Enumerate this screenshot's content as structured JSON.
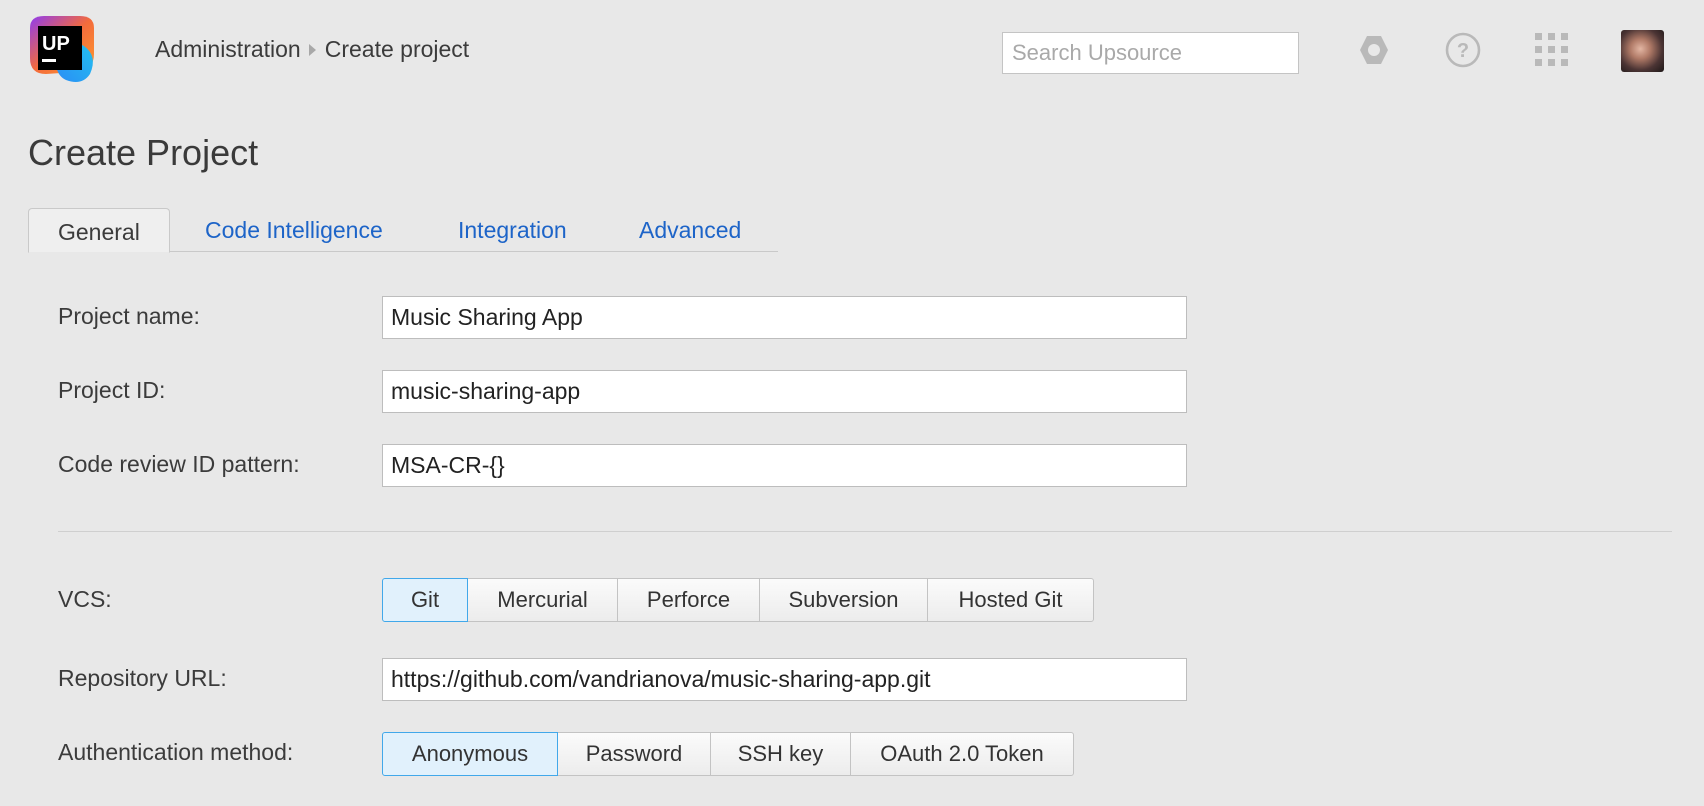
{
  "header": {
    "logo_text": "UP",
    "breadcrumb": {
      "parent": "Administration",
      "current": "Create project"
    },
    "search_placeholder": "Search Upsource"
  },
  "page": {
    "title": "Create Project"
  },
  "tabs": [
    {
      "label": "General",
      "active": true
    },
    {
      "label": "Code Intelligence",
      "active": false
    },
    {
      "label": "Integration",
      "active": false
    },
    {
      "label": "Advanced",
      "active": false
    }
  ],
  "form": {
    "project_name": {
      "label": "Project name:",
      "value": "Music Sharing App"
    },
    "project_id": {
      "label": "Project ID:",
      "value": "music-sharing-app"
    },
    "review_pattern": {
      "label": "Code review ID pattern:",
      "value": "MSA-CR-{}"
    },
    "vcs": {
      "label": "VCS:",
      "options": [
        "Git",
        "Mercurial",
        "Perforce",
        "Subversion",
        "Hosted Git"
      ],
      "selected": "Git"
    },
    "repo_url": {
      "label": "Repository URL:",
      "value": "https://github.com/vandrianova/music-sharing-app.git"
    },
    "auth": {
      "label": "Authentication method:",
      "options": [
        "Anonymous",
        "Password",
        "SSH key",
        "OAuth 2.0 Token"
      ],
      "selected": "Anonymous"
    }
  },
  "colors": {
    "link": "#1d64c8",
    "active_border": "#41a8ea",
    "active_bg": "#e1f1fc"
  }
}
